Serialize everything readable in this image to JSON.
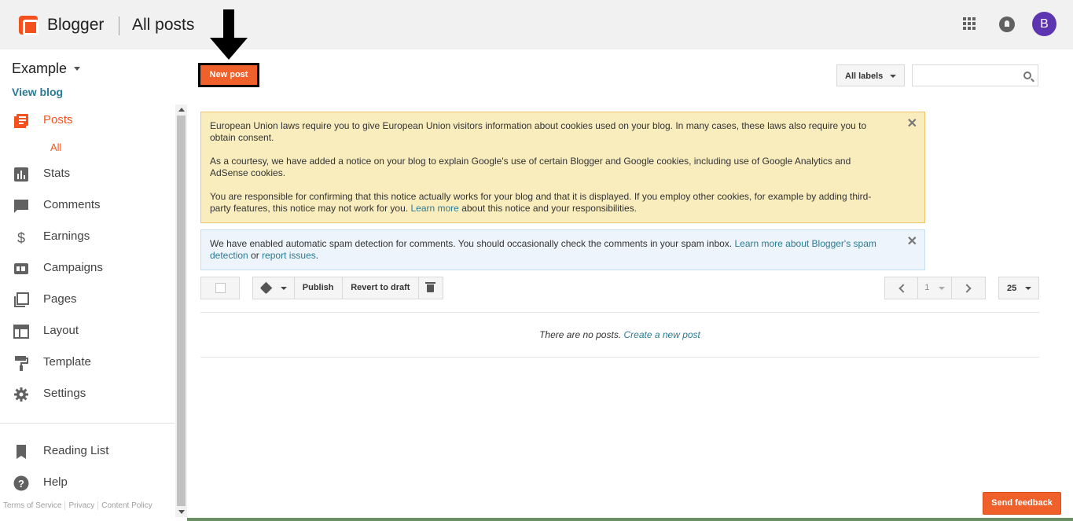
{
  "header": {
    "brand": "Blogger",
    "title": "All posts",
    "avatar_letter": "B"
  },
  "sidebar": {
    "blog_name": "Example",
    "view_blog": "View blog",
    "items": [
      {
        "label": "Posts",
        "icon": "posts-icon",
        "active": true
      },
      {
        "label": "Stats",
        "icon": "stats-icon"
      },
      {
        "label": "Comments",
        "icon": "comments-icon"
      },
      {
        "label": "Earnings",
        "icon": "dollar-icon"
      },
      {
        "label": "Campaigns",
        "icon": "campaigns-icon"
      },
      {
        "label": "Pages",
        "icon": "pages-icon"
      },
      {
        "label": "Layout",
        "icon": "layout-icon"
      },
      {
        "label": "Template",
        "icon": "paint-roller-icon"
      },
      {
        "label": "Settings",
        "icon": "gear-icon"
      }
    ],
    "sub_all": "All",
    "reading_list": "Reading List",
    "help": "Help",
    "footer_links": [
      "Terms of Service",
      "Privacy",
      "Content Policy"
    ]
  },
  "main": {
    "new_post": "New post",
    "labels_filter": "All labels",
    "search_placeholder": "",
    "cookie_notice": {
      "p1": "European Union laws require you to give European Union visitors information about cookies used on your blog. In many cases, these laws also require you to obtain consent.",
      "p2": "As a courtesy, we have added a notice on your blog to explain Google's use of certain Blogger and Google cookies, including use of Google Analytics and AdSense cookies.",
      "p3_before": "You are responsible for confirming that this notice actually works for your blog and that it is displayed. If you employ other cookies, for example by adding third-party features, this notice may not work for you.",
      "p3_link": "Learn more",
      "p3_after": "about this notice and your responsibilities."
    },
    "spam_notice": {
      "before": "We have enabled automatic spam detection for comments. You should occasionally check the comments in your spam inbox.",
      "link1": "Learn more about Blogger's spam detection",
      "middle": "or",
      "link2": "report issues",
      "after": "."
    },
    "toolbar": {
      "publish": "Publish",
      "revert": "Revert to draft",
      "page": "1",
      "per_page": "25"
    },
    "empty_text": "There are no posts.",
    "empty_link": "Create a new post"
  },
  "feedback": "Send feedback",
  "colors": {
    "accent": "#f4511e",
    "link": "#2b7a94",
    "avatar": "#5e35b1"
  }
}
